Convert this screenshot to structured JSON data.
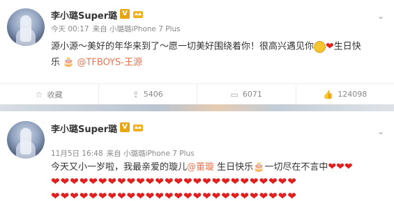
{
  "post1": {
    "username": "李小璐Super璐",
    "verified_badge": "V",
    "meta_time": "今天 00:17",
    "meta_source": "来自 小璐璐iPhone 7 Plus",
    "content_line1": "源小源～美好的年华来到了～愿一切美好围绕着你！很高兴遇见你",
    "content_line2_a": "生日快",
    "content_line2_b": "乐",
    "mention": "@TFBOYS-王源",
    "actions": {
      "favorite_label": "收藏",
      "repost_count": "5406",
      "comment_count": "6071",
      "like_count": "124098"
    }
  },
  "post2": {
    "username": "李小璐Super璐",
    "verified_badge": "V",
    "meta_time": "11月5日 16:48",
    "meta_source": "来自 小璐璐iPhone 7 Plus",
    "content_a": "今天又小一岁啦，我最亲爱的璇儿",
    "mention": "@董璇",
    "content_b": " 生日快乐",
    "content_c": "一切尽在不言中"
  },
  "icons": [
    "chevron-down-icon",
    "star-icon",
    "repost-icon",
    "comment-icon",
    "like-icon",
    "smiley-icon",
    "heart-icon",
    "cake-icon",
    "crown-icon"
  ],
  "colors": {
    "link": "#eb7350",
    "heart": "#e0201e",
    "badge": "#e8a514"
  }
}
